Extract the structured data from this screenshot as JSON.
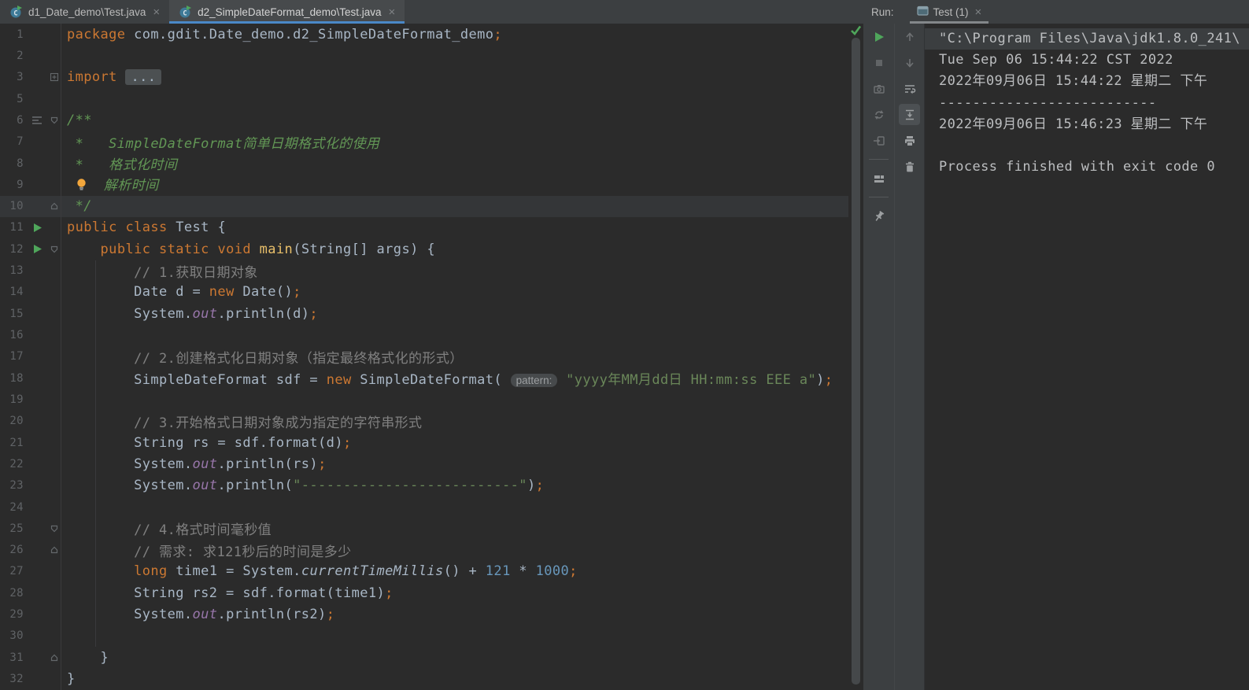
{
  "editor_tabs": [
    {
      "label": "d1_Date_demo\\Test.java",
      "active": false
    },
    {
      "label": "d2_SimpleDateFormat_demo\\Test.java",
      "active": true
    }
  ],
  "run_panel": {
    "run_label": "Run:",
    "tab_label": "Test (1)",
    "toolbar_left": [
      {
        "icon": "play",
        "name": "rerun-button"
      },
      {
        "icon": "stop",
        "name": "stop-button"
      },
      {
        "icon": "camera",
        "name": "thread-dump-camera-button"
      },
      {
        "icon": "rerunfailed",
        "name": "rerun-failed-button"
      },
      {
        "icon": "arrowin",
        "name": "arrow-into-square-button"
      },
      {
        "sep": true
      },
      {
        "icon": "layout",
        "name": "restore-layout-button"
      },
      {
        "sep": true
      },
      {
        "icon": "pin",
        "name": "pin-tab-button"
      }
    ],
    "toolbar_right": [
      {
        "icon": "up",
        "name": "navigate-up-button"
      },
      {
        "icon": "down",
        "name": "navigate-down-button"
      },
      {
        "icon": "softwrap",
        "name": "soft-wrap-button"
      },
      {
        "icon": "scrollend",
        "name": "scroll-to-end-button",
        "selected": true
      },
      {
        "icon": "print",
        "name": "print-button"
      },
      {
        "icon": "trash",
        "name": "clear-console-button"
      }
    ]
  },
  "editor": {
    "lines": [
      {
        "n": "1",
        "tokens": [
          [
            "kw",
            "package"
          ],
          [
            "pl",
            " com.gdit.Date_demo.d2_SimpleDateFormat_demo"
          ],
          [
            "sc",
            ";"
          ]
        ]
      },
      {
        "n": "2",
        "tokens": []
      },
      {
        "n": "3",
        "fold": "plus",
        "tokens": [
          [
            "kw",
            "import"
          ],
          [
            "pl",
            " "
          ],
          [
            "fb",
            "..."
          ]
        ]
      },
      {
        "n": "5",
        "tokens": []
      },
      {
        "n": "6",
        "g": "list",
        "fold": "down",
        "tokens": [
          [
            "dc",
            "/**"
          ]
        ]
      },
      {
        "n": "7",
        "tokens": [
          [
            "dc",
            " *   SimpleDateFormat简单日期格式化的使用"
          ]
        ]
      },
      {
        "n": "8",
        "tokens": [
          [
            "dc",
            " *   格式化时间"
          ]
        ]
      },
      {
        "n": "9",
        "tokens": [
          [
            "pl",
            " "
          ],
          [
            "blb",
            ""
          ],
          [
            "dc",
            "  解析时间"
          ]
        ]
      },
      {
        "n": "10",
        "fold": "up",
        "caret": true,
        "tokens": [
          [
            "dc",
            " */"
          ]
        ]
      },
      {
        "n": "11",
        "g": "run",
        "tokens": [
          [
            "kw",
            "public"
          ],
          [
            "pl",
            " "
          ],
          [
            "kw",
            "class"
          ],
          [
            "pl",
            " Test {"
          ]
        ]
      },
      {
        "n": "12",
        "g": "run",
        "fold": "down",
        "tokens": [
          [
            "pl",
            "    "
          ],
          [
            "kw",
            "public"
          ],
          [
            "pl",
            " "
          ],
          [
            "kw",
            "static"
          ],
          [
            "pl",
            " "
          ],
          [
            "kw",
            "void"
          ],
          [
            "pl",
            " "
          ],
          [
            "mt",
            "main"
          ],
          [
            "pl",
            "(String[] args) {"
          ]
        ]
      },
      {
        "n": "13",
        "tokens": [
          [
            "cm",
            "        // 1.获取日期对象"
          ]
        ]
      },
      {
        "n": "14",
        "tokens": [
          [
            "pl",
            "        Date d = "
          ],
          [
            "kw",
            "new"
          ],
          [
            "pl",
            " Date()"
          ],
          [
            "sc",
            ";"
          ]
        ]
      },
      {
        "n": "15",
        "tokens": [
          [
            "pl",
            "        System."
          ],
          [
            "fd",
            "out"
          ],
          [
            "pl",
            ".println(d)"
          ],
          [
            "sc",
            ";"
          ]
        ]
      },
      {
        "n": "16",
        "tokens": []
      },
      {
        "n": "17",
        "tokens": [
          [
            "cm",
            "        // 2.创建格式化日期对象（指定最终格式化的形式）"
          ]
        ]
      },
      {
        "n": "18",
        "tokens": [
          [
            "pl",
            "        SimpleDateFormat sdf = "
          ],
          [
            "kw",
            "new"
          ],
          [
            "pl",
            " SimpleDateFormat( "
          ],
          [
            "ph",
            "pattern:"
          ],
          [
            "pl",
            " "
          ],
          [
            "st",
            "\"yyyy年MM月dd日 HH:mm:ss EEE a\""
          ],
          [
            "pl",
            ")"
          ],
          [
            "sc",
            ";"
          ]
        ]
      },
      {
        "n": "19",
        "tokens": []
      },
      {
        "n": "20",
        "tokens": [
          [
            "cm",
            "        // 3.开始格式日期对象成为指定的字符串形式"
          ]
        ]
      },
      {
        "n": "21",
        "tokens": [
          [
            "pl",
            "        String rs = sdf.format(d)"
          ],
          [
            "sc",
            ";"
          ]
        ]
      },
      {
        "n": "22",
        "tokens": [
          [
            "pl",
            "        System."
          ],
          [
            "fd",
            "out"
          ],
          [
            "pl",
            ".println(rs)"
          ],
          [
            "sc",
            ";"
          ]
        ]
      },
      {
        "n": "23",
        "tokens": [
          [
            "pl",
            "        System."
          ],
          [
            "fd",
            "out"
          ],
          [
            "pl",
            ".println("
          ],
          [
            "st",
            "\"--------------------------\""
          ],
          [
            "pl",
            ")"
          ],
          [
            "sc",
            ";"
          ]
        ]
      },
      {
        "n": "24",
        "tokens": []
      },
      {
        "n": "25",
        "fold": "down",
        "tokens": [
          [
            "cm",
            "        // 4.格式时间毫秒值"
          ]
        ]
      },
      {
        "n": "26",
        "fold": "up",
        "tokens": [
          [
            "cm",
            "        // 需求: 求121秒后的时间是多少"
          ]
        ]
      },
      {
        "n": "27",
        "tokens": [
          [
            "pl",
            "        "
          ],
          [
            "kw",
            "long"
          ],
          [
            "pl",
            " time1 = System."
          ],
          [
            "sm",
            "currentTimeMillis"
          ],
          [
            "pl",
            "() + "
          ],
          [
            "nm",
            "121"
          ],
          [
            "pl",
            " * "
          ],
          [
            "nm",
            "1000"
          ],
          [
            "sc",
            ";"
          ]
        ]
      },
      {
        "n": "28",
        "tokens": [
          [
            "pl",
            "        String rs2 = sdf.format(time1)"
          ],
          [
            "sc",
            ";"
          ]
        ]
      },
      {
        "n": "29",
        "tokens": [
          [
            "pl",
            "        System."
          ],
          [
            "fd",
            "out"
          ],
          [
            "pl",
            ".println(rs2)"
          ],
          [
            "sc",
            ";"
          ]
        ]
      },
      {
        "n": "30",
        "tokens": []
      },
      {
        "n": "31",
        "fold": "up",
        "tokens": [
          [
            "pl",
            "    }"
          ]
        ]
      },
      {
        "n": "32",
        "tokens": [
          [
            "pl",
            "}"
          ]
        ]
      }
    ]
  },
  "console": {
    "lines": [
      {
        "text": "\"C:\\Program Files\\Java\\jdk1.8.0_241\\",
        "hl": true
      },
      {
        "text": "Tue Sep 06 15:44:22 CST 2022"
      },
      {
        "text": "2022年09月06日 15:44:22 星期二 下午"
      },
      {
        "text": "--------------------------"
      },
      {
        "text": "2022年09月06日 15:46:23 星期二 下午"
      },
      {
        "text": ""
      },
      {
        "text": "Process finished with exit code 0"
      }
    ]
  },
  "colors": {
    "editor_bg": "#2B2B2B",
    "panel_bg": "#3C3F41",
    "keyword": "#CC7832",
    "string": "#6A8759",
    "comment": "#808080",
    "doc_comment": "#629755",
    "number": "#6897BB",
    "field": "#9876AA",
    "method_decl": "#E8BF6A",
    "line_number": "#606366",
    "active_tab_underline": "#4A88C7",
    "run_green": "#4FA65B",
    "console_text": "#BCBEC0"
  }
}
